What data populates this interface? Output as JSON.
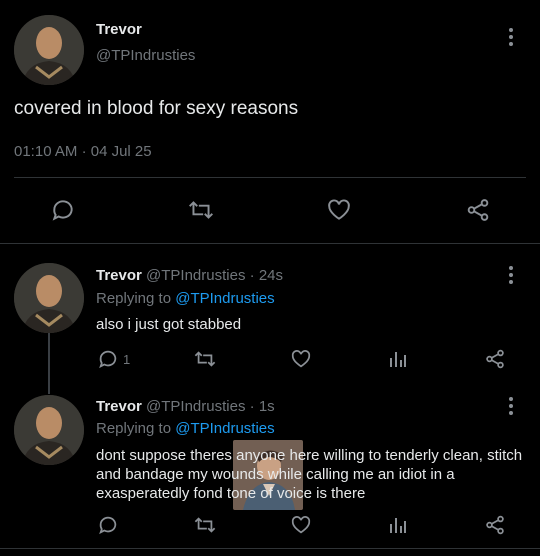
{
  "main_tweet": {
    "name": "Trevor",
    "handle": "@TPIndrusties",
    "text": "covered in blood for sexy reasons",
    "time": "01:10 AM",
    "date": "04 Jul 25"
  },
  "replies": [
    {
      "name": "Trevor",
      "handle": "@TPIndrusties",
      "age": "24s",
      "replying_to_label": "Replying to",
      "replying_to_handle": "@TPIndrusties",
      "text": "also i just got stabbed",
      "reply_count": "1"
    },
    {
      "name": "Trevor",
      "handle": "@TPIndrusties",
      "age": "1s",
      "replying_to_label": "Replying to",
      "replying_to_handle": "@TPIndrusties",
      "text": "dont suppose theres anyone here willing to tenderly clean, stitch and bandage my wounds while calling me an idiot in a exasperatedly fond tone of voice is there"
    }
  ],
  "icons": [
    "reply-icon",
    "retweet-icon",
    "like-icon",
    "share-icon",
    "analytics-icon",
    "more-icon"
  ],
  "colors": {
    "background": "#000000",
    "text": "#e7e9ea",
    "muted": "#71767b",
    "link": "#1d9bf0",
    "divider": "#2f3336"
  }
}
